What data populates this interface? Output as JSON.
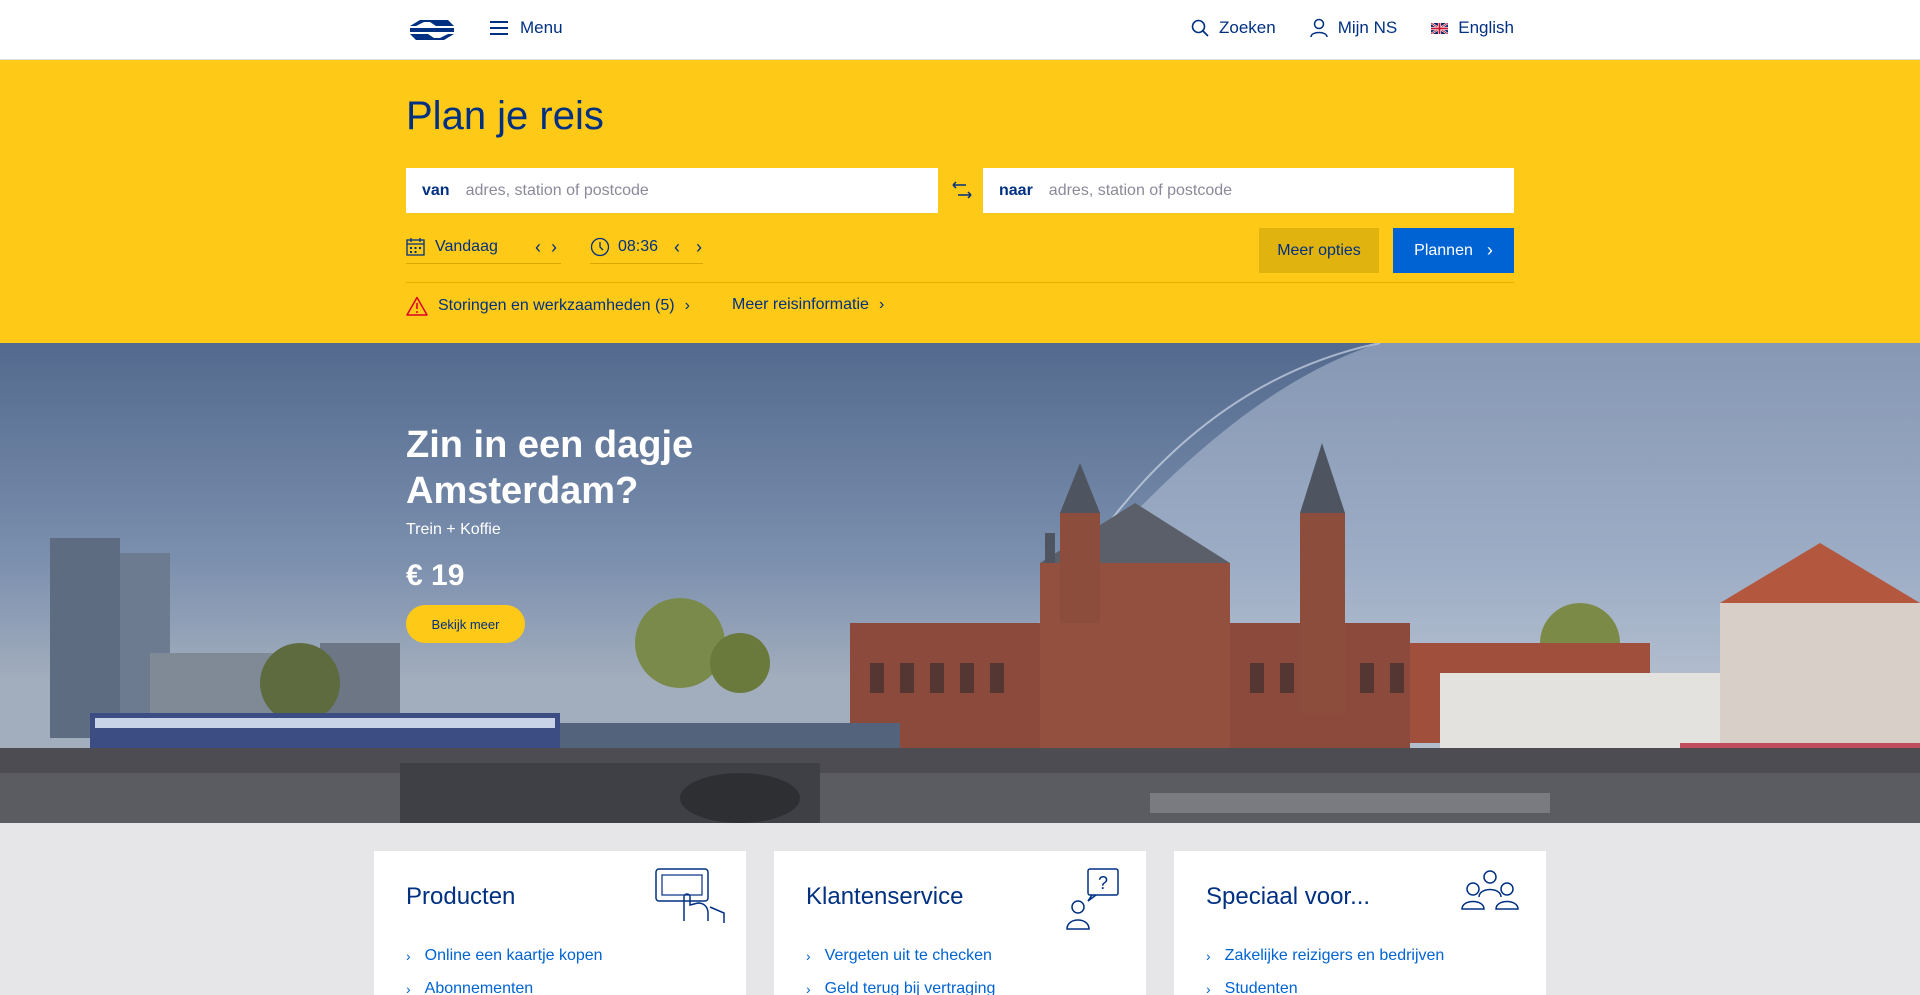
{
  "header": {
    "logo_name": "ns-logo",
    "menu_label": "Menu",
    "search_label": "Zoeken",
    "account_label": "Mijn NS",
    "language_label": "English"
  },
  "planner": {
    "title": "Plan je reis",
    "from_label": "van",
    "from_placeholder": "adres, station of postcode",
    "to_label": "naar",
    "to_placeholder": "adres, station of postcode",
    "date_value": "Vandaag",
    "time_value": "08:36",
    "more_options_label": "Meer opties",
    "plan_label": "Plannen",
    "disruptions_label": "Storingen en werkzaamheden (5)",
    "travel_info_label": "Meer reisinformatie"
  },
  "hero": {
    "title": "Zin in een dagje Amsterdam?",
    "subtitle": "Trein + Koffie",
    "price": "€ 19",
    "cta_label": "Bekijk meer"
  },
  "cards": [
    {
      "title": "Producten",
      "icon": "ov-card-icon",
      "links": [
        "Online een kaartje kopen",
        "Abonnementen"
      ]
    },
    {
      "title": "Klantenservice",
      "icon": "customer-service-icon",
      "links": [
        "Vergeten uit te checken",
        "Geld terug bij vertraging"
      ]
    },
    {
      "title": "Speciaal voor...",
      "icon": "group-icon",
      "links": [
        "Zakelijke reizigers en bedrijven",
        "Studenten"
      ]
    }
  ],
  "colors": {
    "brand_yellow": "#ffc917",
    "brand_blue": "#003082",
    "action_blue": "#0063d3",
    "warning_red": "#db0029"
  }
}
